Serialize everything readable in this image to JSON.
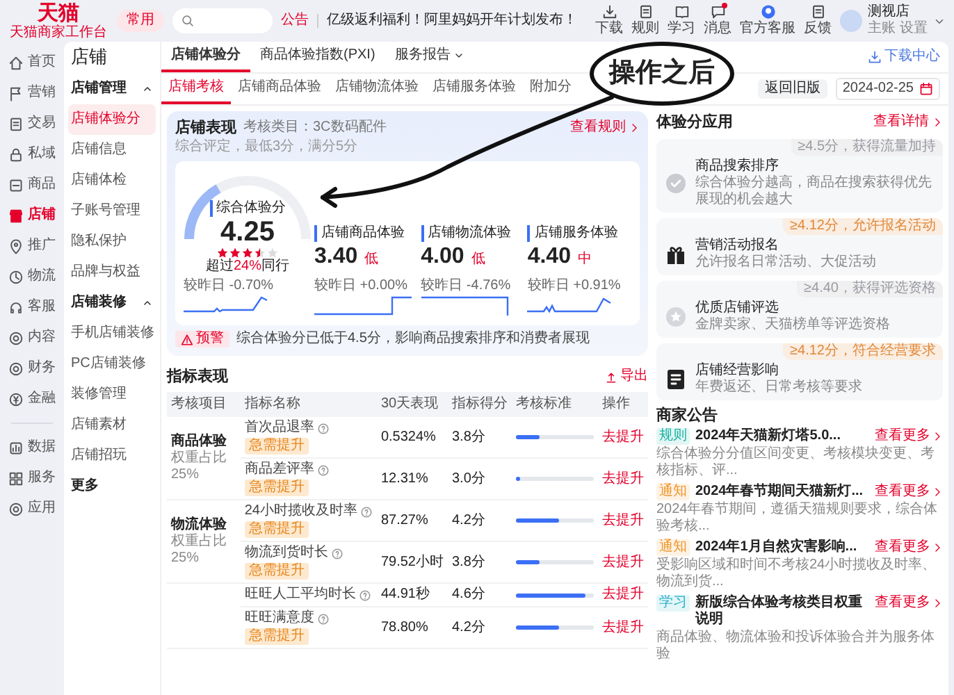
{
  "header": {
    "logo": "天猫",
    "logo_subtitle": "天猫商家工作台",
    "pinned": "常用",
    "notice_label": "公告",
    "notice": "亿级返利福利！阿里妈妈开年计划发布！",
    "shortcuts": [
      {
        "label": "下载",
        "unread": false
      },
      {
        "label": "规则",
        "unread": false
      },
      {
        "label": "学习",
        "unread": false
      },
      {
        "label": "消息",
        "unread": true
      },
      {
        "label": "官方客服",
        "unread": false
      },
      {
        "label": "反馈",
        "unread": false
      }
    ],
    "user": {
      "name": "测视店",
      "role": "主账",
      "settings": "设置"
    }
  },
  "nav": {
    "primary": [
      {
        "label": "首页",
        "selected": false
      },
      {
        "label": "营销",
        "selected": false
      },
      {
        "label": "交易",
        "selected": false
      },
      {
        "label": "私域",
        "selected": false
      },
      {
        "label": "商品",
        "selected": false
      },
      {
        "label": "店铺",
        "selected": true
      },
      {
        "label": "推广",
        "selected": false
      },
      {
        "label": "物流",
        "selected": false
      },
      {
        "label": "客服",
        "selected": false
      },
      {
        "label": "内容",
        "selected": false
      },
      {
        "label": "财务",
        "selected": false
      },
      {
        "label": "金融",
        "selected": false
      }
    ],
    "secondary": [
      {
        "label": "数据",
        "selected": false
      },
      {
        "label": "服务",
        "selected": false
      },
      {
        "label": "应用",
        "selected": false
      }
    ]
  },
  "sidebar": {
    "title": "店铺",
    "groups": [
      {
        "label": "店铺管理",
        "expanded": true,
        "items": [
          {
            "label": "店铺体验分",
            "selected": true
          },
          {
            "label": "店铺信息",
            "selected": false
          },
          {
            "label": "店铺体检",
            "selected": false
          },
          {
            "label": "子账号管理",
            "selected": false
          },
          {
            "label": "隐私保护",
            "selected": false
          },
          {
            "label": "品牌与权益",
            "selected": false
          }
        ]
      },
      {
        "label": "店铺装修",
        "expanded": true,
        "items": [
          {
            "label": "手机店铺装修",
            "selected": false
          },
          {
            "label": "PC店铺装修",
            "selected": false
          },
          {
            "label": "装修管理",
            "selected": false
          },
          {
            "label": "店铺素材",
            "selected": false
          },
          {
            "label": "店铺招玩",
            "selected": false
          }
        ]
      }
    ],
    "more": "更多"
  },
  "tabs": [
    {
      "label": "店铺体验分",
      "selected": true,
      "dropdown": false
    },
    {
      "label": "商品体验指数(PXI)",
      "selected": false,
      "dropdown": false
    },
    {
      "label": "服务报告",
      "selected": false,
      "dropdown": true
    }
  ],
  "download_center": "下载中心",
  "subtabs": [
    {
      "label": "店铺考核",
      "selected": true
    },
    {
      "label": "店铺商品体验",
      "selected": false
    },
    {
      "label": "店铺物流体验",
      "selected": false
    },
    {
      "label": "店铺服务体验",
      "selected": false
    },
    {
      "label": "附加分",
      "selected": false
    }
  ],
  "old_version": "返回旧版",
  "date": "2024-02-25",
  "performance": {
    "title": "店铺表现",
    "category": "考核类目：3C数码配件",
    "rules_link": "查看规则",
    "note": "综合评定，最低3分，满分5分",
    "overall": {
      "label": "综合体验分",
      "score": "4.25",
      "level": 0.25,
      "stars": 3.5,
      "rank_prefix": "超过",
      "rank_value": "24%",
      "rank_suffix": "同行",
      "change": "较昨日 -0.70%"
    },
    "metrics": [
      {
        "label": "店铺商品体验",
        "score": "3.40",
        "grade": "低",
        "change": "较昨日 +0.00%"
      },
      {
        "label": "店铺物流体验",
        "score": "4.00",
        "grade": "低",
        "change": "较昨日 -4.76%"
      },
      {
        "label": "店铺服务体验",
        "score": "4.40",
        "grade": "中",
        "change": "较昨日 +0.91%"
      }
    ],
    "warning": {
      "tag": "预警",
      "text": "综合体验分已低于4.5分，影响商品搜索排序和消费者展现"
    }
  },
  "metrics_table": {
    "title": "指标表现",
    "export": "导出",
    "columns": [
      "考核项目",
      "指标名称",
      "30天表现",
      "指标得分",
      "考核标准",
      "操作"
    ],
    "groups": [
      {
        "name": "商品体验",
        "weight": "权重占比25%",
        "rows": [
          {
            "metric": "首次品退率",
            "tag": "急需提升",
            "value": "0.5324%",
            "score": "3.8分",
            "level": 0.3,
            "action": "去提升"
          },
          {
            "metric": "商品差评率",
            "tag": "急需提升",
            "value": "12.31%",
            "score": "3.0分",
            "level": 0.05,
            "action": "去提升"
          }
        ]
      },
      {
        "name": "物流体验",
        "weight": "权重占比25%",
        "rows": [
          {
            "metric": "24小时揽收及时率",
            "tag": "急需提升",
            "value": "87.27%",
            "score": "4.2分",
            "level": 0.55,
            "action": "去提升"
          },
          {
            "metric": "物流到货时长",
            "tag": "急需提升",
            "value": "79.52小时",
            "score": "3.8分",
            "level": 0.3,
            "action": "去提升"
          }
        ]
      },
      {
        "rows": [
          {
            "metric": "旺旺人工平均时长",
            "value": "44.91秒",
            "score": "4.6分",
            "level": 0.9,
            "action": "去提升"
          },
          {
            "metric": "旺旺满意度",
            "tag": "急需提升",
            "value": "78.80%",
            "score": "4.2分",
            "level": 0.55,
            "action": "去提升"
          }
        ]
      }
    ]
  },
  "apps": {
    "title": "体验分应用",
    "link": "查看详情",
    "cards": [
      {
        "badge": "≥4.5分，获得流量加持",
        "color": "#9a9ca3",
        "title": "商品搜索排序",
        "desc": "综合体验分越高，商品在搜索获得优先展现的机会越大"
      },
      {
        "badge": "≥4.12分，允许报名活动",
        "color": "#e0893a",
        "title": "营销活动报名",
        "desc": "允许报名日常活动、大促活动"
      },
      {
        "badge": "≥4.40，获得评选资格",
        "color": "#9a9ca3",
        "title": "优质店铺评选",
        "desc": "金牌卖家、天猫榜单等评选资格"
      },
      {
        "badge": "≥4.12分，符合经营要求",
        "color": "#e0893a",
        "title": "店铺经营影响",
        "desc": "年费返还、日常考核等要求"
      }
    ]
  },
  "notices": {
    "title": "商家公告",
    "items": [
      {
        "tag": "规则",
        "color": "#17b3a3",
        "title": "2024年天猫新灯塔5.0...",
        "more": "查看更多",
        "desc": "综合体验分分值区间变更、考核模块变更、考核指标、评..."
      },
      {
        "tag": "通知",
        "color": "#f0962a",
        "title": "2024年春节期间天猫新灯...",
        "more": "查看更多",
        "desc": "2024年春节期间，遵循天猫规则要求，综合体验考核..."
      },
      {
        "tag": "通知",
        "color": "#f0962a",
        "title": "2024年1月自然灾害影响...",
        "more": "查看更多",
        "desc": "受影响区域和时间不考核24小时揽收及时率、物流到货..."
      },
      {
        "tag": "学习",
        "color": "#27b0c8",
        "title": "新版综合体验考核类目权重说明",
        "more": "查看更多",
        "desc": "商品体验、物流体验和投诉体验合并为服务体验"
      }
    ]
  },
  "callout": {
    "text": "操作之后"
  }
}
